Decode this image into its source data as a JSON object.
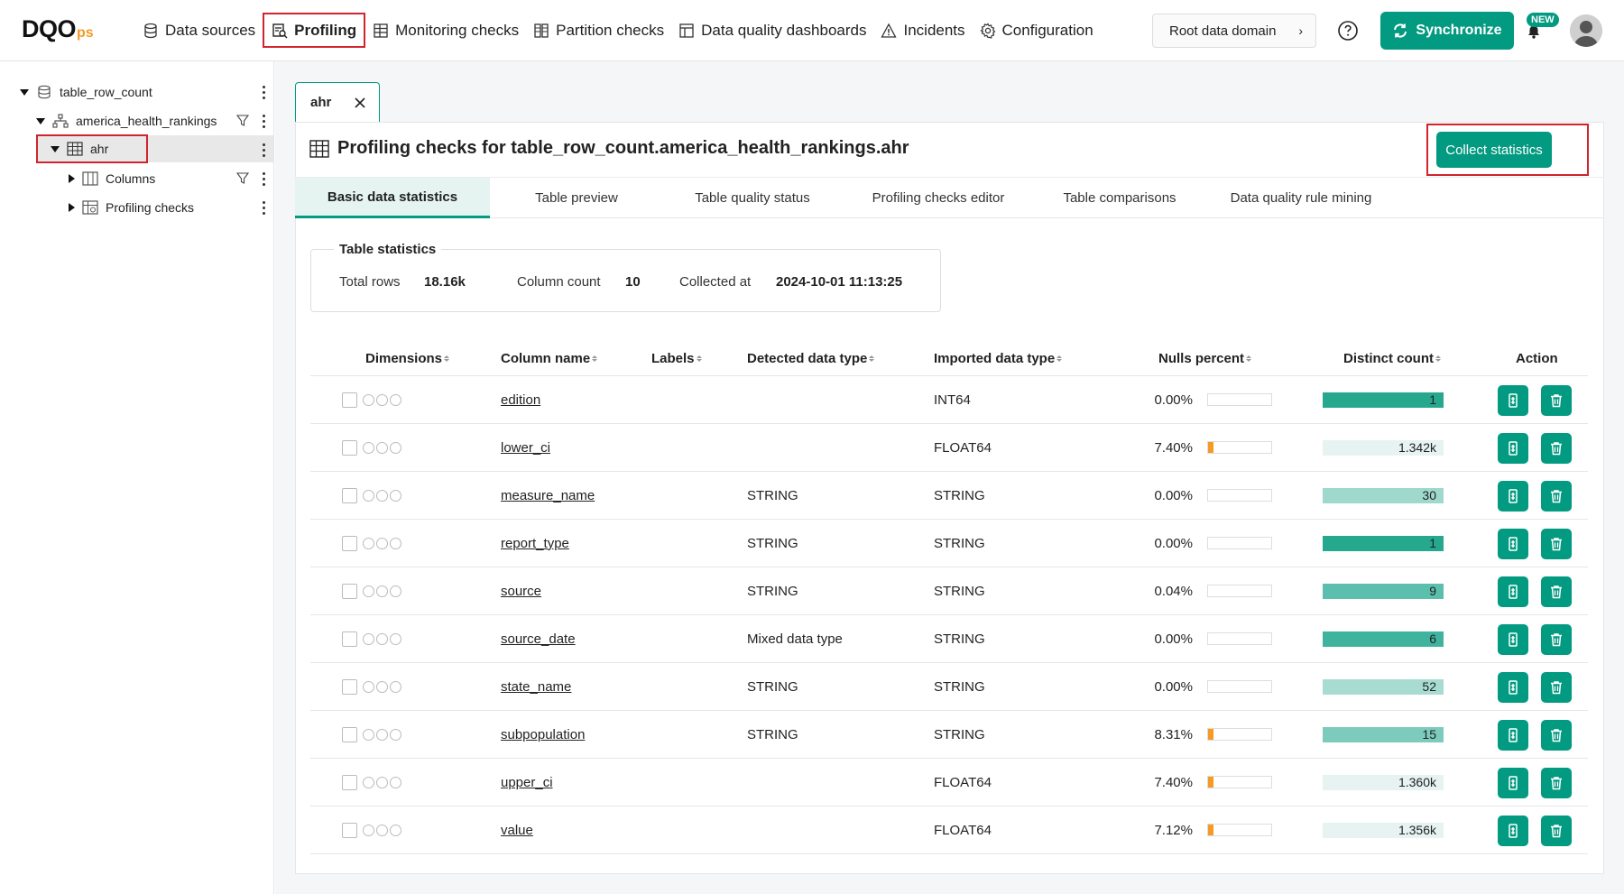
{
  "logo": {
    "main": "DQO",
    "suffix": "ps"
  },
  "nav": {
    "items": [
      {
        "label": "Data sources",
        "icon": "database-icon"
      },
      {
        "label": "Profiling",
        "icon": "profiling-icon",
        "active": true
      },
      {
        "label": "Monitoring checks",
        "icon": "table-icon"
      },
      {
        "label": "Partition checks",
        "icon": "partition-icon"
      },
      {
        "label": "Data quality dashboards",
        "icon": "dashboard-icon"
      },
      {
        "label": "Incidents",
        "icon": "warning-icon"
      },
      {
        "label": "Configuration",
        "icon": "gear-icon"
      }
    ],
    "domain": "Root data domain",
    "synchronize": "Synchronize",
    "new_badge": "NEW"
  },
  "tree": {
    "connection": "table_row_count",
    "schema": "america_health_rankings",
    "table": "ahr",
    "columns": "Columns",
    "profiling_checks": "Profiling checks"
  },
  "tab": {
    "label": "ahr"
  },
  "panel": {
    "title": "Profiling checks for table_row_count.america_health_rankings.ahr",
    "collect_button": "Collect statistics",
    "subtabs": [
      "Basic data statistics",
      "Table preview",
      "Table quality status",
      "Profiling checks editor",
      "Table comparisons",
      "Data quality rule mining"
    ]
  },
  "table_stats": {
    "legend": "Table statistics",
    "total_rows_label": "Total rows",
    "total_rows": "18.16k",
    "column_count_label": "Column count",
    "column_count": "10",
    "collected_at_label": "Collected at",
    "collected_at": "2024-10-01 11:13:25"
  },
  "columns_table": {
    "headers": {
      "dimensions": "Dimensions",
      "column_name": "Column name",
      "labels": "Labels",
      "detected_type": "Detected data type",
      "imported_type": "Imported data type",
      "nulls_percent": "Nulls percent",
      "distinct_count": "Distinct count",
      "action": "Action"
    },
    "rows": [
      {
        "name": "edition",
        "detected": "",
        "imported": "INT64",
        "nulls": "0.00%",
        "null_fraction": 0.0,
        "distinct": "1",
        "distinct_fill": 1.0,
        "distinct_color": "#26a88f"
      },
      {
        "name": "lower_ci",
        "detected": "",
        "imported": "FLOAT64",
        "nulls": "7.40%",
        "null_fraction": 0.074,
        "distinct": "1.342k",
        "distinct_fill": 0.0,
        "distinct_color": "#26a88f"
      },
      {
        "name": "measure_name",
        "detected": "STRING",
        "imported": "STRING",
        "nulls": "0.00%",
        "null_fraction": 0.0,
        "distinct": "30",
        "distinct_fill": 1.0,
        "distinct_color": "#9fd8cd"
      },
      {
        "name": "report_type",
        "detected": "STRING",
        "imported": "STRING",
        "nulls": "0.00%",
        "null_fraction": 0.0,
        "distinct": "1",
        "distinct_fill": 1.0,
        "distinct_color": "#26a88f"
      },
      {
        "name": "source",
        "detected": "STRING",
        "imported": "STRING",
        "nulls": "0.04%",
        "null_fraction": 0.0,
        "distinct": "9",
        "distinct_fill": 1.0,
        "distinct_color": "#5cbfae"
      },
      {
        "name": "source_date",
        "detected": "Mixed data type",
        "imported": "STRING",
        "nulls": "0.00%",
        "null_fraction": 0.0,
        "distinct": "6",
        "distinct_fill": 1.0,
        "distinct_color": "#40b39f"
      },
      {
        "name": "state_name",
        "detected": "STRING",
        "imported": "STRING",
        "nulls": "0.00%",
        "null_fraction": 0.0,
        "distinct": "52",
        "distinct_fill": 1.0,
        "distinct_color": "#a8dcd2"
      },
      {
        "name": "subpopulation",
        "detected": "STRING",
        "imported": "STRING",
        "nulls": "8.31%",
        "null_fraction": 0.0831,
        "distinct": "15",
        "distinct_fill": 1.0,
        "distinct_color": "#7ccbbc"
      },
      {
        "name": "upper_ci",
        "detected": "",
        "imported": "FLOAT64",
        "nulls": "7.40%",
        "null_fraction": 0.074,
        "distinct": "1.360k",
        "distinct_fill": 0.0,
        "distinct_color": "#26a88f"
      },
      {
        "name": "value",
        "detected": "",
        "imported": "FLOAT64",
        "nulls": "7.12%",
        "null_fraction": 0.0712,
        "distinct": "1.356k",
        "distinct_fill": 0.0,
        "distinct_color": "#26a88f"
      }
    ]
  }
}
